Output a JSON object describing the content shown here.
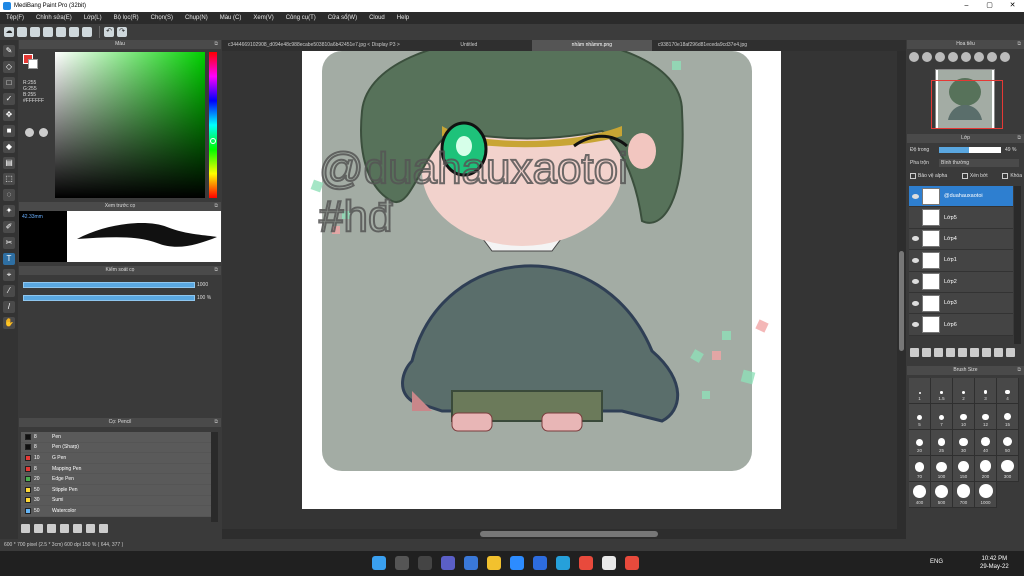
{
  "window": {
    "title": "MediBang Paint Pro (32bit)",
    "min": "–",
    "max": "▢",
    "close": "✕"
  },
  "menu": [
    "Tệp(F)",
    "Chỉnh sửa(E)",
    "Lớp(L)",
    "Bộ lọc(R)",
    "Chọn(S)",
    "Chụp(N)",
    "Màu (C)",
    "Xem(V)",
    "Công cụ(T)",
    "Cửa sổ(W)",
    "Cloud",
    "Help"
  ],
  "color_panel": {
    "title": "Màu",
    "r": "R:255",
    "g": "G:255",
    "b": "B:255",
    "hex": "#FFFFFF"
  },
  "brush_preview": {
    "title": "Xem trước cọ",
    "size": "42.33mm"
  },
  "brush_control": {
    "title": "Kiểm soát cọ",
    "size_val": "1000",
    "opacity_val": "100 %"
  },
  "brush_list": {
    "title": "Cọ: Pencil",
    "items": [
      {
        "size": "8",
        "name": "Pen",
        "color": "#111111"
      },
      {
        "size": "8",
        "name": "Pen (Sharp)",
        "color": "#111111"
      },
      {
        "size": "10",
        "name": "G Pen",
        "color": "#e53935"
      },
      {
        "size": "8",
        "name": "Mapping Pen",
        "color": "#e53935"
      },
      {
        "size": "20",
        "name": "Edge Pen",
        "color": "#4caf50"
      },
      {
        "size": "50",
        "name": "Stipple Pen",
        "color": "#fdd835"
      },
      {
        "size": "30",
        "name": "Sumi",
        "color": "#fdd835"
      },
      {
        "size": "50",
        "name": "Watercolor",
        "color": "#64b5f6"
      }
    ]
  },
  "tabs": [
    "c3444669102908_d094e48c988ecabe503810a6b42451e7.jpg < Display P3 >",
    "Untitled",
    "nhầm nhầmm.png",
    "c938170e18af296d81eceda9cd37e4.jpg"
  ],
  "canvas": {
    "watermark_line1": "@duahauxaotoi",
    "watermark_line2": "#hđ"
  },
  "navigator": {
    "title": "Hoa tiêu"
  },
  "layers": {
    "title": "Lớp",
    "opacity_label": "Độ trong",
    "opacity_val": "49 %",
    "blend_label": "Pha trộn",
    "blend_val": "Bình thường",
    "protect_alpha": "Bảo vệ alpha",
    "clipping": "Xén bớt",
    "lock": "Khóa",
    "items": [
      "@duahauxaotoi",
      "Lớp5",
      "Lớp4",
      "Lớp1",
      "Lớp2",
      "Lớp3",
      "Lớp6"
    ]
  },
  "brush_size": {
    "title": "Brush Size",
    "values": [
      "1",
      "1.5",
      "2",
      "3",
      "4",
      "5",
      "7",
      "10",
      "12",
      "15",
      "20",
      "25",
      "30",
      "40",
      "50",
      "70",
      "100",
      "150",
      "200",
      "300",
      "400",
      "500",
      "700",
      "1000"
    ]
  },
  "status": "600 * 700 pixel  (2.5 * 3cm)  600 dpi  150 %  ( 644, 377 )",
  "taskbar": {
    "lang": "ENG",
    "time": "10:42 PM",
    "date": "29-May-22"
  },
  "colors": {
    "accent": "#2e7fd0",
    "slider": "#5aa7e0",
    "red": "#e53935"
  }
}
